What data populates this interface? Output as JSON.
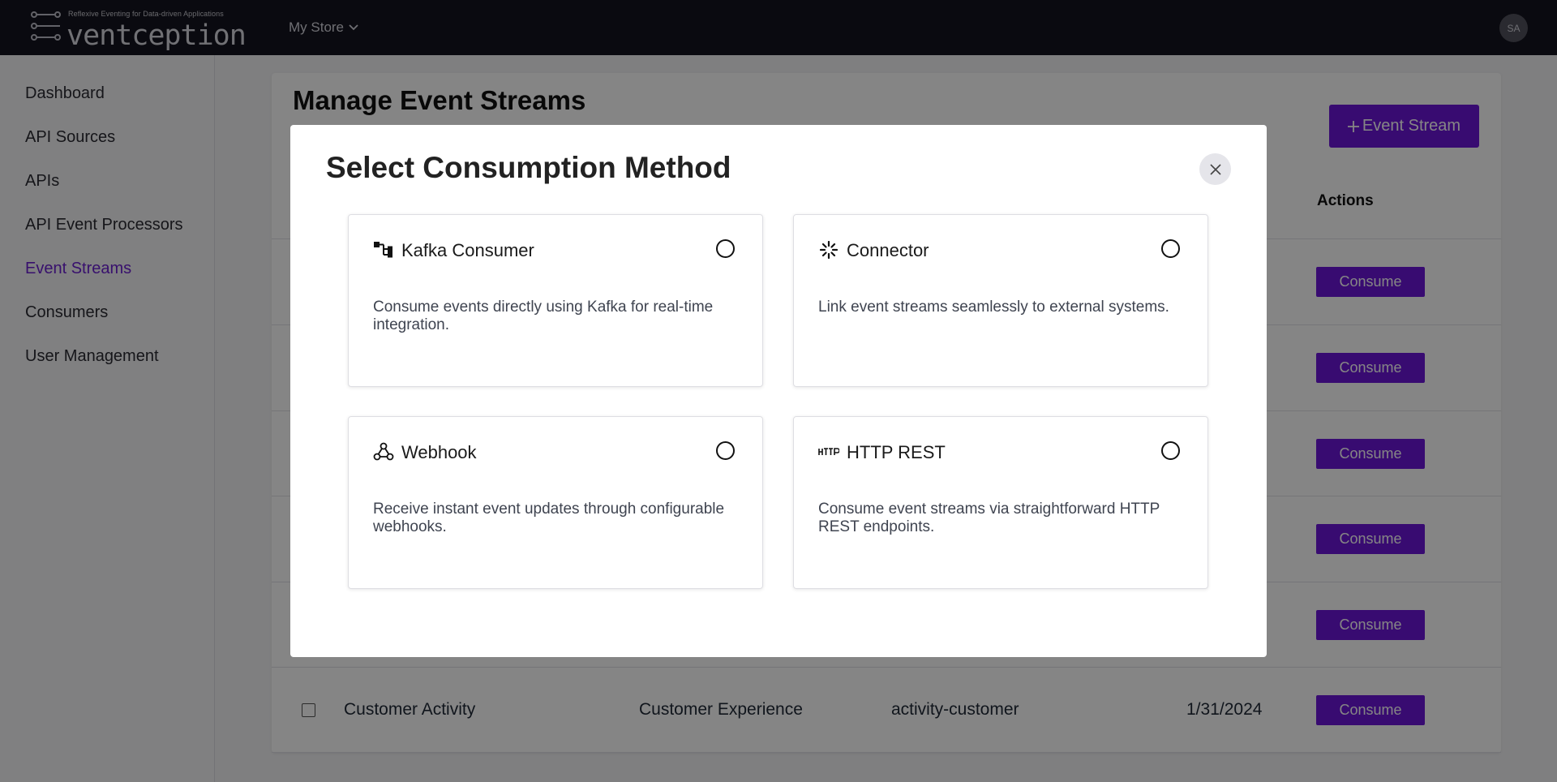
{
  "header": {
    "logo_tagline": "Reflexive Eventing for Data-driven Applications",
    "logo_text": "ventception",
    "store_label": "My Store",
    "avatar_initials": "SA"
  },
  "sidebar": {
    "items": [
      {
        "label": "Dashboard"
      },
      {
        "label": "API Sources"
      },
      {
        "label": "APIs"
      },
      {
        "label": "API Event Processors"
      },
      {
        "label": "Event Streams"
      },
      {
        "label": "Consumers"
      },
      {
        "label": "User Management"
      }
    ],
    "active": "Event Streams"
  },
  "main": {
    "title": "Manage Event Streams",
    "add_button_label": "Event Stream",
    "add_button_icon": "plus-icon",
    "actions_header": "Actions",
    "consume_label": "Consume",
    "last_row": {
      "name": "Customer Activity",
      "category": "Customer Experience",
      "topic": "activity-customer",
      "date": "1/31/2024"
    }
  },
  "modal": {
    "title": "Select Consumption Method",
    "close_icon": "close-icon",
    "options": [
      {
        "title": "Kafka Consumer",
        "icon": "kafka-icon",
        "description": "Consume events directly using Kafka for real-time integration."
      },
      {
        "title": "Connector",
        "icon": "connector-icon",
        "description": "Link event streams seamlessly to external systems."
      },
      {
        "title": "Webhook",
        "icon": "webhook-icon",
        "description": "Receive instant event updates through configurable webhooks."
      },
      {
        "title": "HTTP REST",
        "icon": "http-icon",
        "description": "Consume event streams via straightforward HTTP REST endpoints."
      }
    ]
  },
  "colors": {
    "accent": "#6b16d8",
    "topbar": "#15151f",
    "active_nav": "#6b1fd1"
  }
}
